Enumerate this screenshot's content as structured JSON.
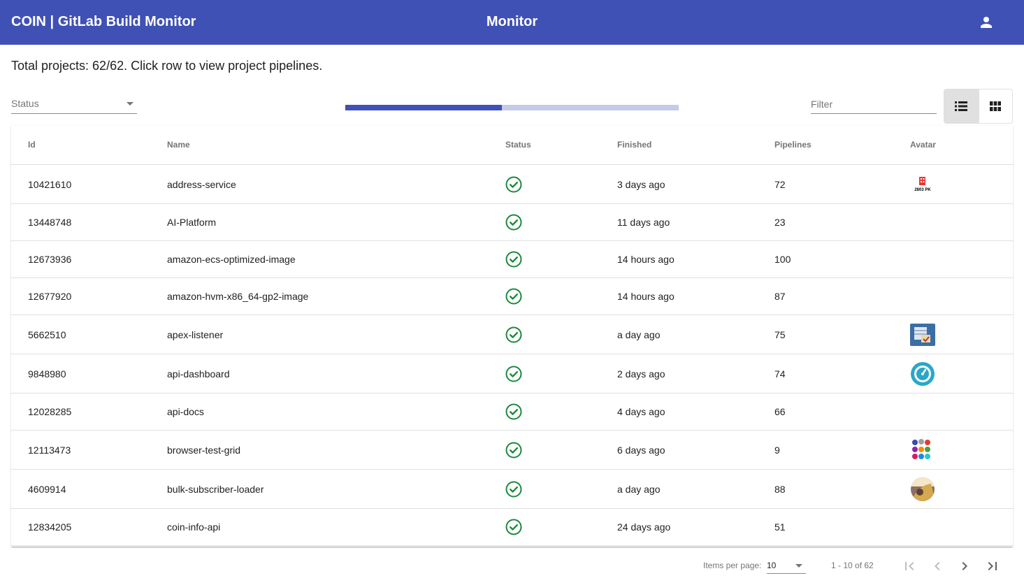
{
  "header": {
    "app_title": "COIN | GitLab Build Monitor",
    "page_title": "Monitor",
    "account_icon": "account-icon",
    "color": "#3f51b5"
  },
  "summary": "Total projects: 62/62. Click row to view project pipelines.",
  "controls": {
    "status_placeholder": "Status",
    "filter_placeholder": "Filter",
    "progress_fraction": 0.47,
    "view_mode": "list",
    "list_icon": "list-view-icon",
    "grid_icon": "grid-view-icon"
  },
  "table": {
    "columns": [
      "Id",
      "Name",
      "Status",
      "Finished",
      "Pipelines",
      "Avatar"
    ],
    "rows": [
      {
        "id": "10421610",
        "name": "address-service",
        "status": "success",
        "finished": "3 days ago",
        "pipelines": "72",
        "avatar": "building-2803-logo"
      },
      {
        "id": "13448748",
        "name": "AI-Platform",
        "status": "success",
        "finished": "11 days ago",
        "pipelines": "23",
        "avatar": ""
      },
      {
        "id": "12673936",
        "name": "amazon-ecs-optimized-image",
        "status": "success",
        "finished": "14 hours ago",
        "pipelines": "100",
        "avatar": ""
      },
      {
        "id": "12677920",
        "name": "amazon-hvm-x86_64-gp2-image",
        "status": "success",
        "finished": "14 hours ago",
        "pipelines": "87",
        "avatar": ""
      },
      {
        "id": "5662510",
        "name": "apex-listener",
        "status": "success",
        "finished": "a day ago",
        "pipelines": "75",
        "avatar": "database-check-logo"
      },
      {
        "id": "9848980",
        "name": "api-dashboard",
        "status": "success",
        "finished": "2 days ago",
        "pipelines": "74",
        "avatar": "speedometer-logo"
      },
      {
        "id": "12028285",
        "name": "api-docs",
        "status": "success",
        "finished": "4 days ago",
        "pipelines": "66",
        "avatar": ""
      },
      {
        "id": "12113473",
        "name": "browser-test-grid",
        "status": "success",
        "finished": "6 days ago",
        "pipelines": "9",
        "avatar": "color-dots-logo"
      },
      {
        "id": "4609914",
        "name": "bulk-subscriber-loader",
        "status": "success",
        "finished": "a day ago",
        "pipelines": "88",
        "avatar": "photo-logo"
      },
      {
        "id": "12834205",
        "name": "coin-info-api",
        "status": "success",
        "finished": "24 days ago",
        "pipelines": "51",
        "avatar": ""
      }
    ],
    "status_color": "#1b8a3a"
  },
  "paginator": {
    "items_per_page_label": "Items per page:",
    "page_size": "10",
    "range_label": "1 - 10 of 62",
    "first_icon": "first-page-icon",
    "prev_icon": "previous-page-icon",
    "next_icon": "next-page-icon",
    "last_icon": "last-page-icon"
  }
}
